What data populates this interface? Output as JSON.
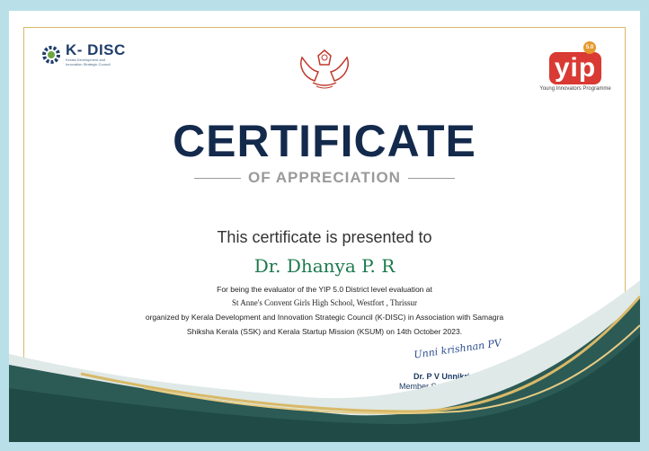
{
  "kdisc_logo": {
    "name": "K- DISC",
    "subtitle": "Kerala Development and Innovation Strategic Council"
  },
  "yip_logo": {
    "wordmark": "yip",
    "version": "5.0",
    "subtitle": "Young Innovators Programme"
  },
  "title": "CERTIFICATE",
  "subtitle": "OF APPRECIATION",
  "presented_to": "This certificate is presented to",
  "recipient": "Dr. Dhanya P. R",
  "body": {
    "line1": "For being the evaluator of the YIP 5.0 District level evaluation at",
    "line2": "St Anne's Convent Girls High School, Westfort , Thrissur",
    "line3": "organized by Kerala Development and Innovation Strategic Council (K-DISC) in Association with Samagra",
    "line4": "Shiksha Kerala (SSK) and Kerala Startup Mission (KSUM) on 14th October 2023."
  },
  "signature": {
    "handwriting": "Unni krishnan PV",
    "name": "Dr. P V Unnikrishnan",
    "title": "Member Secretary, K-DISC"
  },
  "colors": {
    "navy": "#142a4c",
    "green": "#1c7a4c",
    "gold": "#d8b968",
    "teal": "#2c5a55",
    "background": "#b9e0e8"
  }
}
